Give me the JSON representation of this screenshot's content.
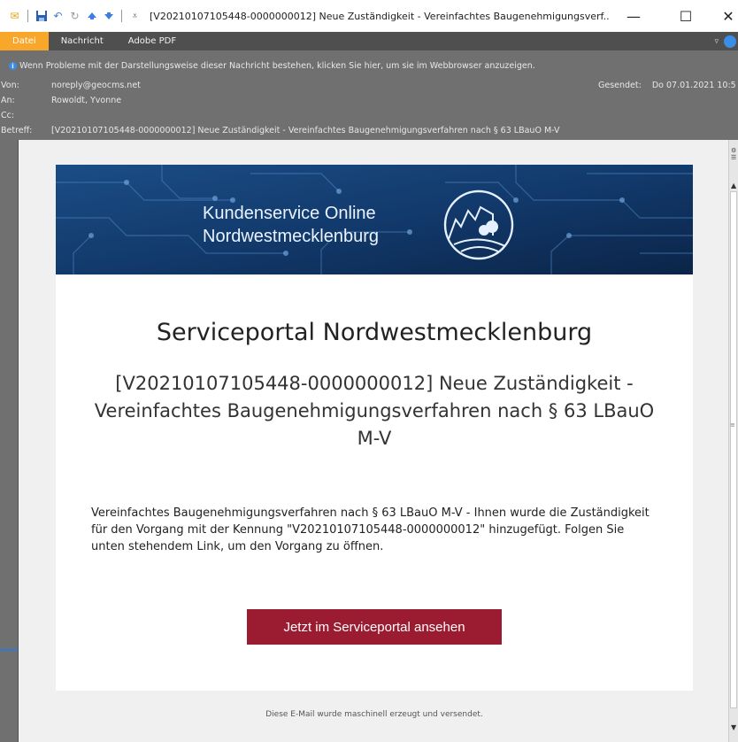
{
  "window": {
    "title": "[V20210107105448-0000000012] Neue Zuständigkeit - Vereinfachtes Baugenehmigungsverf...",
    "controls": {
      "minimize": "—",
      "maximize": "☐",
      "close": "✕"
    }
  },
  "quick_access": [
    {
      "icon": "mail-icon",
      "glyph": "✉"
    },
    {
      "icon": "save-icon",
      "glyph": "💾"
    },
    {
      "icon": "undo-icon",
      "glyph": "↶"
    },
    {
      "icon": "redo-icon",
      "glyph": "↷"
    },
    {
      "icon": "up-arrow-icon",
      "glyph": "▲"
    },
    {
      "icon": "down-arrow-icon",
      "glyph": "▼"
    },
    {
      "icon": "customize-icon",
      "glyph": "▾"
    }
  ],
  "ribbon": {
    "tabs": [
      "Datei",
      "Nachricht",
      "Adobe PDF"
    ],
    "active_tab": "Datei"
  },
  "infobar": "Wenn Probleme mit der Darstellungsweise dieser Nachricht bestehen, klicken Sie hier, um sie im Webbrowser anzuzeigen.",
  "header": {
    "from_label": "Von:",
    "from": "noreply@geocms.net",
    "to_label": "An:",
    "to": "Rowoldt, Yvonne",
    "cc_label": "Cc:",
    "cc": "",
    "subject_label": "Betreff:",
    "subject": "[V20210107105448-0000000012] Neue Zuständigkeit - Vereinfachtes Baugenehmigungsverfahren nach § 63 LBauO M-V",
    "sent_label": "Gesendet:",
    "sent": "Do 07.01.2021 10:5"
  },
  "email": {
    "banner_line1": "Kundenservice Online",
    "banner_line2": "Nordwestmecklenburg",
    "heading": "Serviceportal Nordwestmecklenburg",
    "subheading": "[V20210107105448-0000000012] Neue Zuständigkeit - Vereinfachtes Baugenehmigungsverfahren nach § 63 LBauO M-V",
    "body": "Vereinfachtes Baugenehmigungsverfahren nach § 63 LBauO M-V - Ihnen wurde die Zuständigkeit für den Vorgang mit der Kennung \"V20210107105448-0000000012\" hinzugefügt. Folgen Sie unten stehendem Link, um den Vorgang zu öffnen.",
    "cta_label": "Jetzt im Serviceportal ansehen",
    "footer": "Diese E-Mail wurde maschinell erzeugt und versendet."
  },
  "colors": {
    "accent_tab": "#f8a72a",
    "cta": "#9b1b30",
    "banner": "#0f2c57",
    "header_bg": "#707070"
  }
}
